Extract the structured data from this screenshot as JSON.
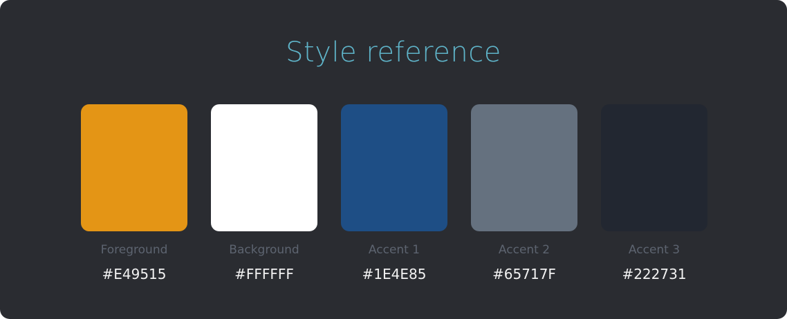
{
  "title": "Style reference",
  "colors": {
    "page_background": "#2a2c31",
    "title": "#5fb4c9",
    "label": "#5d6470",
    "hex_text": "#f2f2f2"
  },
  "swatches": [
    {
      "name": "Foreground",
      "hex": "#E49515",
      "color": "#E49515"
    },
    {
      "name": "Background",
      "hex": "#FFFFFF",
      "color": "#FFFFFF"
    },
    {
      "name": "Accent 1",
      "hex": "#1E4E85",
      "color": "#1E4E85"
    },
    {
      "name": "Accent 2",
      "hex": "#65717F",
      "color": "#65717F"
    },
    {
      "name": "Accent 3",
      "hex": "#222731",
      "color": "#222731"
    }
  ]
}
